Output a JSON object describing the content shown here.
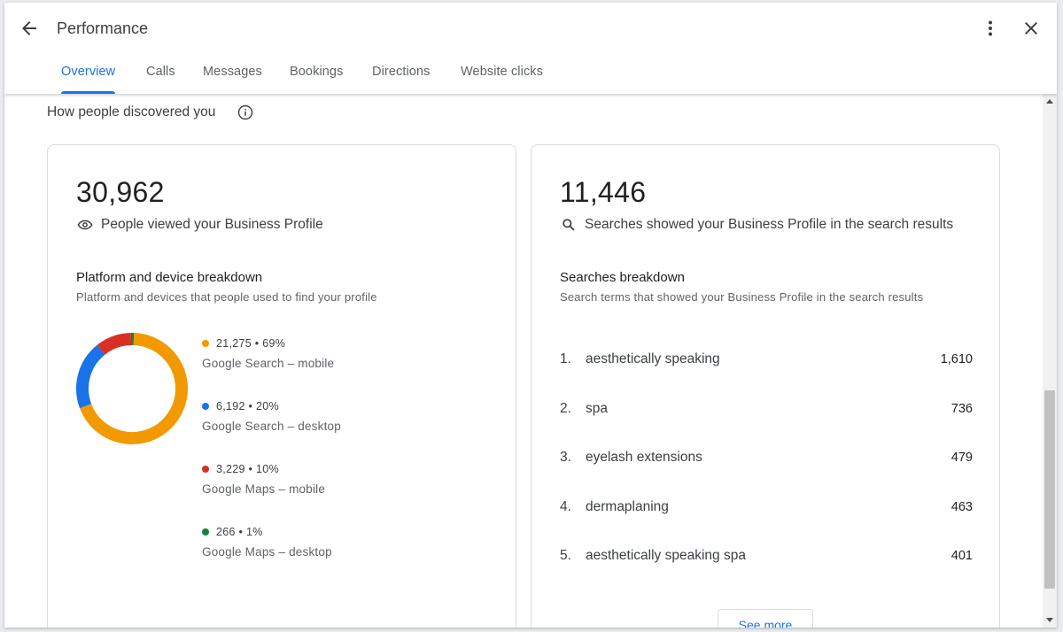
{
  "header": {
    "title": "Performance",
    "tabs": [
      {
        "label": "Overview",
        "active": true
      },
      {
        "label": "Calls",
        "active": false
      },
      {
        "label": "Messages",
        "active": false
      },
      {
        "label": "Bookings",
        "active": false
      },
      {
        "label": "Directions",
        "active": false
      },
      {
        "label": "Website clicks",
        "active": false
      }
    ]
  },
  "section": {
    "title": "How people discovered you"
  },
  "views_card": {
    "total": "30,962",
    "total_label": "People viewed your Business Profile",
    "breakdown_title": "Platform and device breakdown",
    "breakdown_subtitle": "Platform and devices that people used to find your profile",
    "legend": [
      {
        "value": "21,275 • 69%",
        "label": "Google Search – mobile",
        "color": "#f29900"
      },
      {
        "value": "6,192 • 20%",
        "label": "Google Search – desktop",
        "color": "#1a73e8"
      },
      {
        "value": "3,229 • 10%",
        "label": "Google Maps – mobile",
        "color": "#d93025"
      },
      {
        "value": "266 • 1%",
        "label": "Google Maps – desktop",
        "color": "#188038"
      }
    ]
  },
  "searches_card": {
    "total": "11,446",
    "total_label": "Searches showed your Business Profile in the search results",
    "breakdown_title": "Searches breakdown",
    "breakdown_subtitle": "Search terms that showed your Business Profile in the search results",
    "rows": [
      {
        "rank": "1.",
        "term": "aesthetically speaking",
        "count": "1,610"
      },
      {
        "rank": "2.",
        "term": "spa",
        "count": "736"
      },
      {
        "rank": "3.",
        "term": "eyelash extensions",
        "count": "479"
      },
      {
        "rank": "4.",
        "term": "dermaplaning",
        "count": "463"
      },
      {
        "rank": "5.",
        "term": "aesthetically speaking spa",
        "count": "401"
      }
    ],
    "see_more_label": "See more"
  },
  "chart_data": {
    "type": "pie",
    "style": "donut",
    "categories": [
      "Google Search – mobile",
      "Google Search – desktop",
      "Google Maps – mobile",
      "Google Maps – desktop"
    ],
    "values": [
      21275,
      6192,
      3229,
      266
    ],
    "percentages": [
      69,
      20,
      10,
      1
    ],
    "colors": [
      "#f29900",
      "#1a73e8",
      "#d93025",
      "#188038"
    ]
  }
}
